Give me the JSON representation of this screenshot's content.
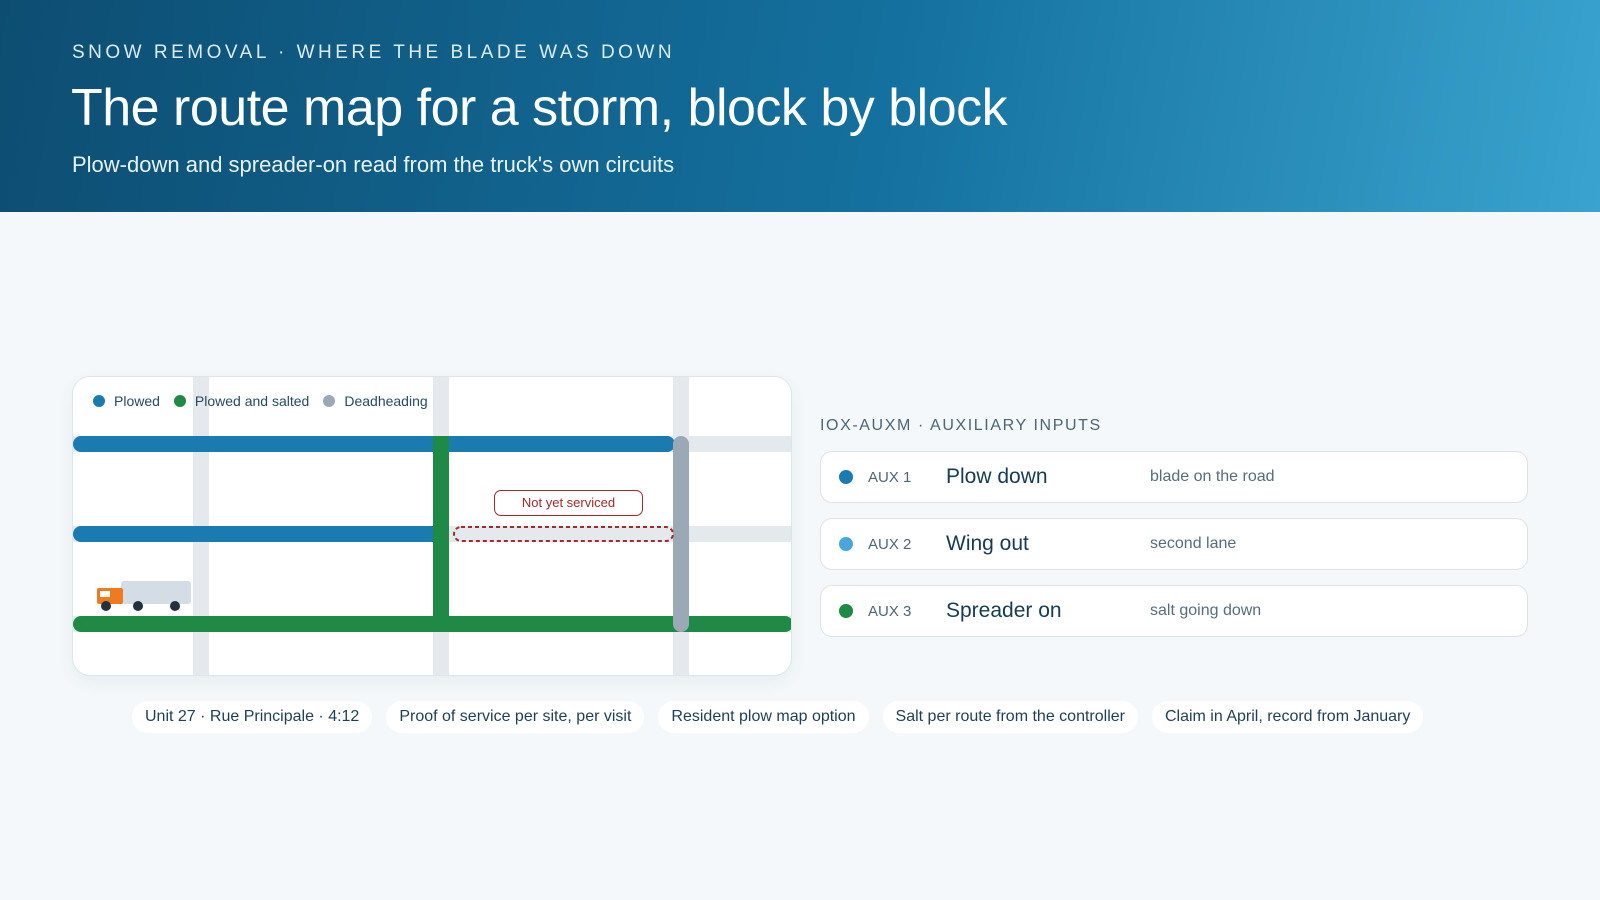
{
  "header": {
    "eyebrow": "SNOW REMOVAL · WHERE THE BLADE WAS DOWN",
    "title": "The route map for a storm, block by block",
    "subtitle": "Plow-down and spreader-on read from the truck's own circuits"
  },
  "map": {
    "legend": [
      {
        "label": "Plowed",
        "color": "#1a7bb0"
      },
      {
        "label": "Plowed and salted",
        "color": "#1e8a45"
      },
      {
        "label": "Deadheading",
        "color": "#9ba8b6"
      }
    ],
    "callout": "Not yet serviced",
    "colors": {
      "street": "#e4e9ee",
      "plowed": "#1a7bb0",
      "salted": "#1e8a45",
      "deadheading": "#9ba8b6",
      "unserviced": "#a32a2a",
      "truck_cab": "#f07a1f",
      "truck_body": "#d4dde5"
    }
  },
  "panel": {
    "heading": "IOX-AUXM · AUXILIARY INPUTS",
    "rows": [
      {
        "code": "AUX 1",
        "label": "Plow down",
        "desc": "blade on the road",
        "color": "#1a7bb0"
      },
      {
        "code": "AUX 2",
        "label": "Wing out",
        "desc": "second lane",
        "color": "#4aa7d8"
      },
      {
        "code": "AUX 3",
        "label": "Spreader on",
        "desc": "salt going down",
        "color": "#1e8a45"
      }
    ]
  },
  "chips": [
    "Unit 27 · Rue Principale · 4:12",
    "Proof of service per site, per visit",
    "Resident plow map option",
    "Salt per route from the controller",
    "Claim in April, record from January"
  ]
}
